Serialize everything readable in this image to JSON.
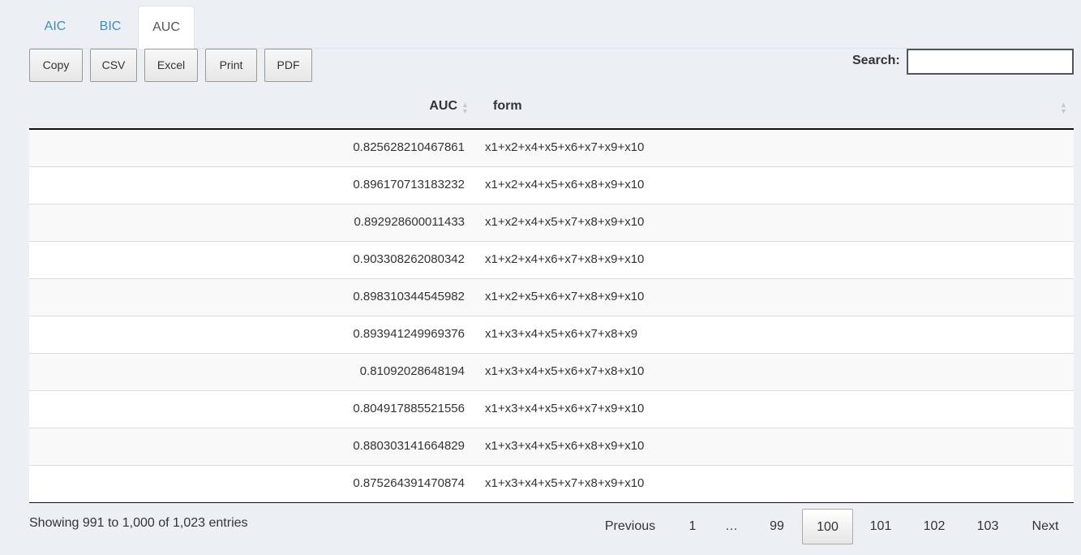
{
  "tabs": [
    {
      "label": "AIC"
    },
    {
      "label": "BIC"
    },
    {
      "label": "AUC"
    }
  ],
  "buttons": {
    "copy": "Copy",
    "csv": "CSV",
    "excel": "Excel",
    "print": "Print",
    "pdf": "PDF"
  },
  "search": {
    "label": "Search:",
    "value": ""
  },
  "table": {
    "headers": {
      "auc": "AUC",
      "form": "form"
    },
    "rows": [
      {
        "auc": "0.825628210467861",
        "form": "x1+x2+x4+x5+x6+x7+x9+x10"
      },
      {
        "auc": "0.896170713183232",
        "form": "x1+x2+x4+x5+x6+x8+x9+x10"
      },
      {
        "auc": "0.892928600011433",
        "form": "x1+x2+x4+x5+x7+x8+x9+x10"
      },
      {
        "auc": "0.903308262080342",
        "form": "x1+x2+x4+x6+x7+x8+x9+x10"
      },
      {
        "auc": "0.898310344545982",
        "form": "x1+x2+x5+x6+x7+x8+x9+x10"
      },
      {
        "auc": "0.893941249969376",
        "form": "x1+x3+x4+x5+x6+x7+x8+x9"
      },
      {
        "auc": "0.81092028648194",
        "form": "x1+x3+x4+x5+x6+x7+x8+x10"
      },
      {
        "auc": "0.804917885521556",
        "form": "x1+x3+x4+x5+x6+x7+x9+x10"
      },
      {
        "auc": "0.880303141664829",
        "form": "x1+x3+x4+x5+x6+x8+x9+x10"
      },
      {
        "auc": "0.875264391470874",
        "form": "x1+x3+x4+x5+x7+x8+x9+x10"
      }
    ]
  },
  "footer": {
    "info": "Showing 991 to 1,000 of 1,023 entries",
    "pagination": {
      "previous": "Previous",
      "first": "1",
      "ellipsis": "…",
      "p99": "99",
      "p100": "100",
      "p101": "101",
      "p102": "102",
      "p103": "103",
      "next": "Next"
    }
  },
  "colors": {
    "background": "#ecf0f5",
    "tab_link": "#3c8dbc"
  }
}
